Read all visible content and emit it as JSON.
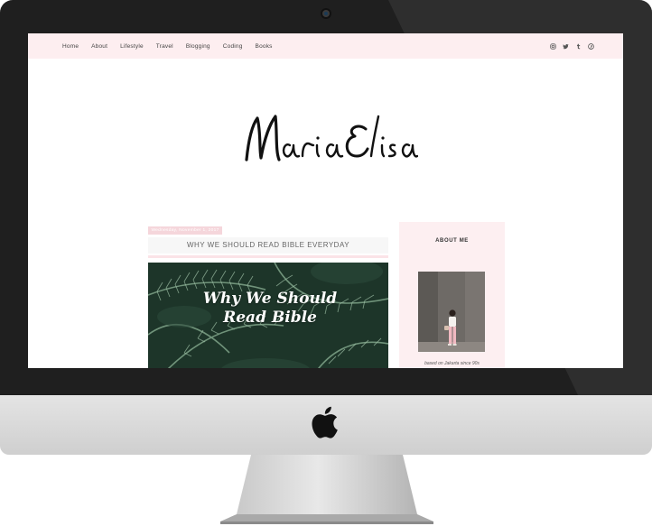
{
  "nav": {
    "items": [
      "Home",
      "About",
      "Lifestyle",
      "Travel",
      "Blogging",
      "Coding",
      "Books"
    ]
  },
  "social_icons": [
    "instagram-icon",
    "twitter-icon",
    "tumblr-icon",
    "pinterest-icon"
  ],
  "logo_text": "Maria Elisa",
  "post": {
    "date": "Wednesday, November 1, 2017",
    "title": "WHY WE SHOULD READ BIBLE EVERYDAY",
    "image_text": "Why We Should Read Bible"
  },
  "sidebar": {
    "title": "ABOUT ME",
    "caption": "based on Jakarta since 90s"
  },
  "colors": {
    "nav_bg": "#fdeef0",
    "accent_pink": "#f5d6db",
    "bezel": "#1f1f1f",
    "chin": "#d6d6d6"
  }
}
